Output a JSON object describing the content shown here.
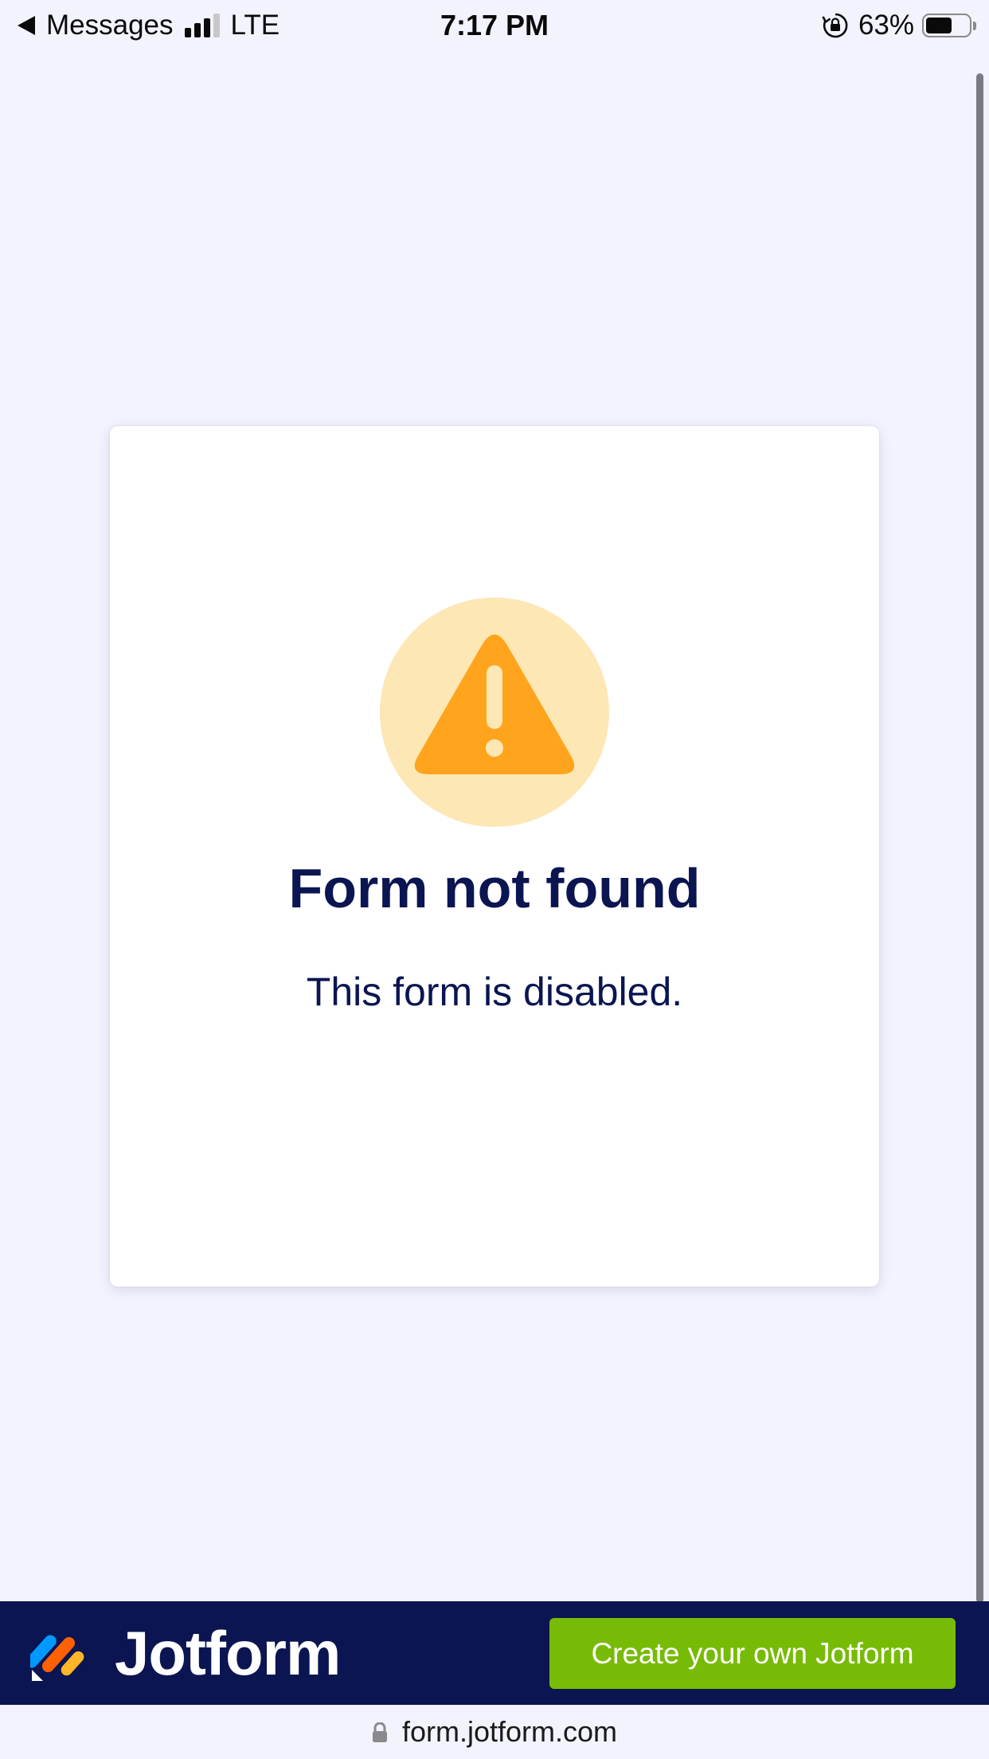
{
  "status_bar": {
    "back_app": "Messages",
    "network": "LTE",
    "time": "7:17 PM",
    "battery": "63%",
    "battery_level": 0.63,
    "signal_bars_active": 3,
    "signal_bars_total": 4
  },
  "card": {
    "icon": "warning-triangle-icon",
    "title": "Form not found",
    "message": "This form is disabled."
  },
  "footer": {
    "brand": "Jotform",
    "cta_label": "Create your own Jotform"
  },
  "browser": {
    "url": "form.jotform.com"
  },
  "colors": {
    "page_background": "#f2f3fd",
    "title_navy": "#0a1551",
    "warning_orange": "#ffa41c",
    "warning_circle": "#fde7b4",
    "cta_green": "#78bb07",
    "footer_navy": "#0a1551"
  }
}
